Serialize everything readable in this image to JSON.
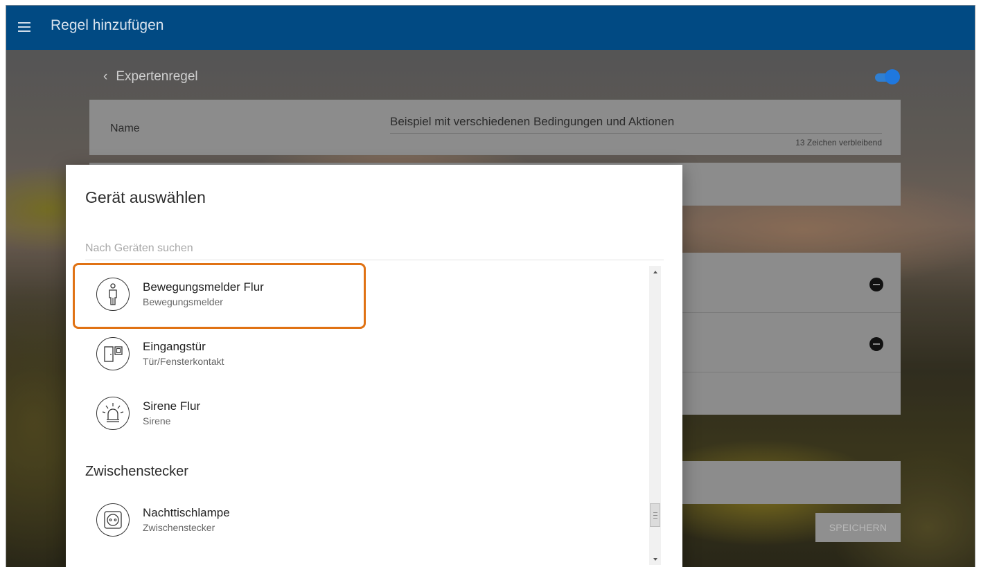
{
  "appbar": {
    "title": "Regel hinzufügen",
    "menu_icon": "hamburger-menu-icon"
  },
  "background_form": {
    "back_label": "Expertenregel",
    "back_icon": "chevron-left-icon",
    "toggle_on": true,
    "name_label": "Name",
    "name_value": "Beispiel mit verschiedenen Bedingungen und Aktionen",
    "name_counter": "13 Zeichen verbleibend",
    "save_label": "SPEICHERN"
  },
  "dialog": {
    "title": "Gerät auswählen",
    "search_placeholder": "Nach Geräten suchen",
    "devices": [
      {
        "name": "Bewegungsmelder Flur",
        "type": "Bewegungsmelder",
        "icon": "motion-sensor-icon",
        "highlighted": true
      },
      {
        "name": "Eingangstür",
        "type": "Tür/Fensterkontakt",
        "icon": "door-contact-icon",
        "highlighted": false
      },
      {
        "name": "Sirene Flur",
        "type": "Sirene",
        "icon": "siren-icon",
        "highlighted": false
      }
    ],
    "section": "Zwischenstecker",
    "section_devices": [
      {
        "name": "Nachttischlampe",
        "type": "Zwischenstecker",
        "icon": "plug-icon"
      }
    ]
  },
  "colors": {
    "appbar": "#014a83",
    "highlight": "#e07214",
    "toggle": "#1f78df"
  }
}
